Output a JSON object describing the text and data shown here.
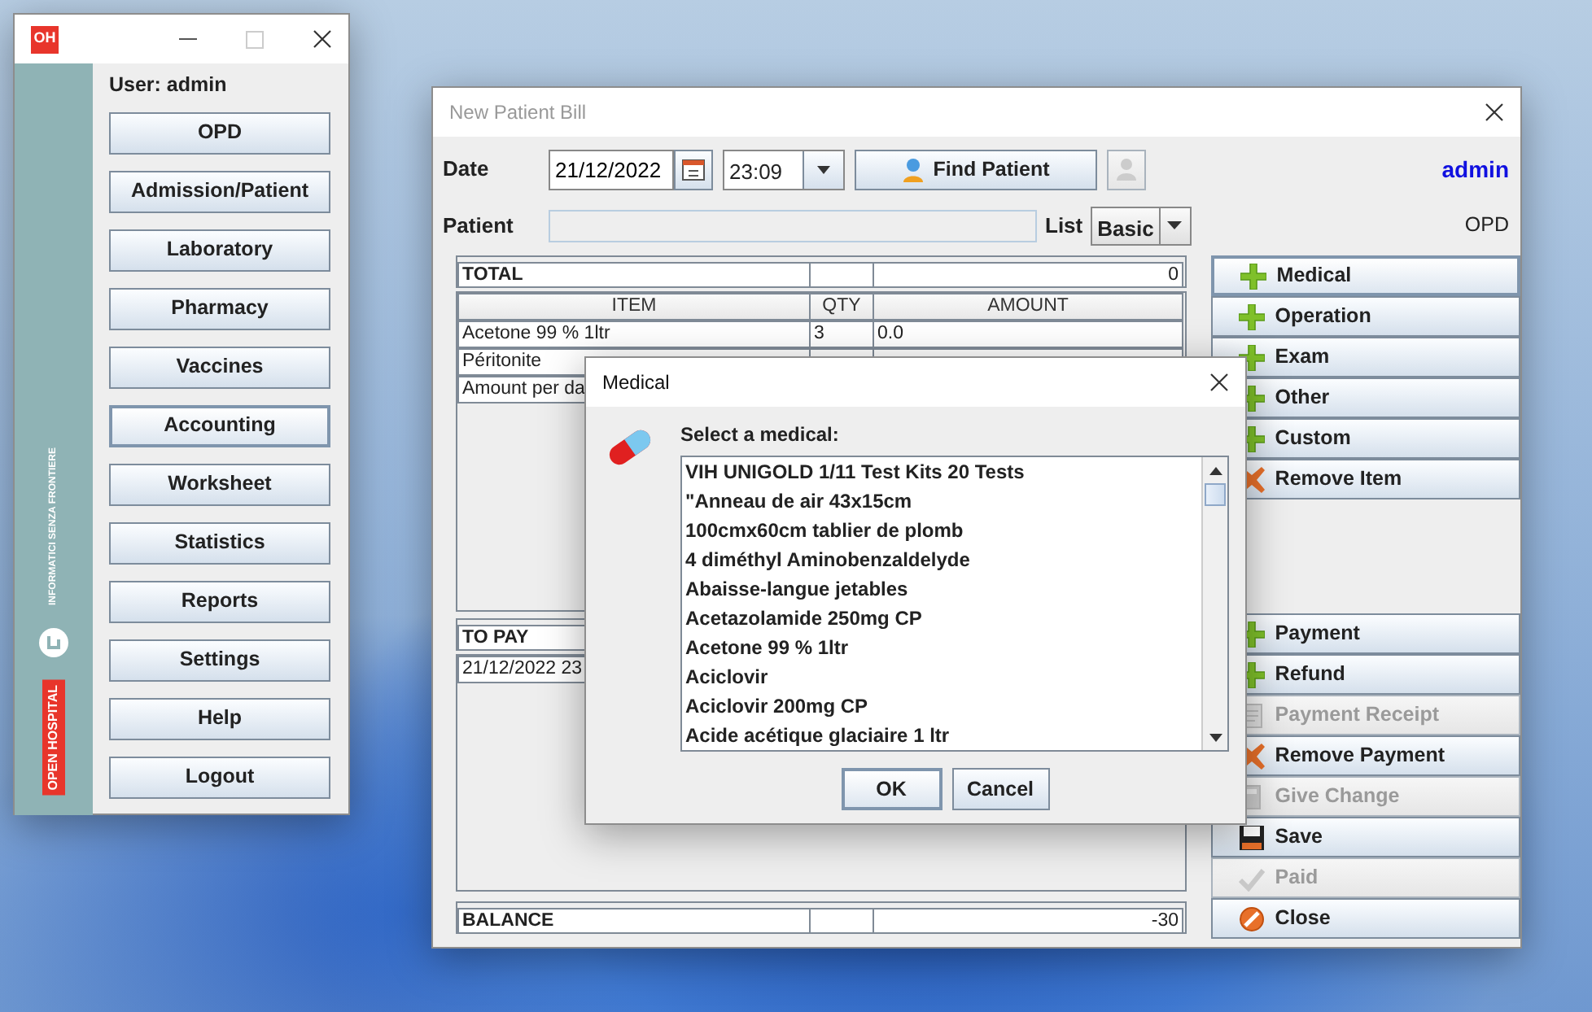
{
  "main_window": {
    "logo_text": "OH",
    "user_label": "User: admin",
    "brand": "OPEN HOSPITAL",
    "partner": "INFORMATICI SENZA FRONTIERE",
    "buttons": [
      {
        "label": "OPD",
        "focused": false
      },
      {
        "label": "Admission/Patient",
        "focused": false
      },
      {
        "label": "Laboratory",
        "focused": false
      },
      {
        "label": "Pharmacy",
        "focused": false
      },
      {
        "label": "Vaccines",
        "focused": false
      },
      {
        "label": "Accounting",
        "focused": true
      },
      {
        "label": "Worksheet",
        "focused": false
      },
      {
        "label": "Statistics",
        "focused": false
      },
      {
        "label": "Reports",
        "focused": false
      },
      {
        "label": "Settings",
        "focused": false
      },
      {
        "label": "Help",
        "focused": false
      },
      {
        "label": "Logout",
        "focused": false
      }
    ]
  },
  "bill_window": {
    "title": "New Patient Bill",
    "date_label": "Date",
    "date": "21/12/2022",
    "time": "23:09",
    "find_patient": {
      "label": "Find Patient"
    },
    "patient_label": "Patient",
    "list_label": "List",
    "list_value": "Basic",
    "user": "admin",
    "ward": "OPD",
    "total": {
      "label": "TOTAL",
      "value": "0"
    },
    "columns": [
      "ITEM",
      "QTY",
      "AMOUNT"
    ],
    "items": [
      {
        "item": "Acetone 99 % 1ltr",
        "qty": "3",
        "amount": "0.0"
      },
      {
        "item": "Péritonite"
      },
      {
        "item": "Amount per da"
      }
    ],
    "to_pay": {
      "label": "TO PAY"
    },
    "payments": [
      {
        "text": "21/12/2022 23"
      }
    ],
    "balance": {
      "label": "BALANCE",
      "value": "-30"
    },
    "item_actions": [
      {
        "label": "Medical",
        "kind": "add",
        "disabled": false,
        "focused": true
      },
      {
        "label": "Operation",
        "kind": "add",
        "disabled": false,
        "focused": false
      },
      {
        "label": "Exam",
        "kind": "add",
        "disabled": false,
        "focused": false
      },
      {
        "label": "Other",
        "kind": "add",
        "disabled": false,
        "focused": false
      },
      {
        "label": "Custom",
        "kind": "add",
        "disabled": false,
        "focused": false
      },
      {
        "label": "Remove Item",
        "kind": "remove",
        "disabled": false,
        "focused": false
      }
    ],
    "payment_actions": [
      {
        "label": "Payment",
        "kind": "add",
        "disabled": false,
        "focused": false
      },
      {
        "label": "Refund",
        "kind": "add",
        "disabled": false,
        "focused": false
      },
      {
        "label": "Payment Receipt",
        "kind": "receipt",
        "disabled": true,
        "focused": false
      },
      {
        "label": "Remove Payment",
        "kind": "remove",
        "disabled": false,
        "focused": false
      },
      {
        "label": "Give Change",
        "kind": "change",
        "disabled": true,
        "focused": false
      },
      {
        "label": "Save",
        "kind": "save",
        "disabled": false,
        "focused": false
      },
      {
        "label": "Paid",
        "kind": "paid",
        "disabled": true,
        "focused": false
      },
      {
        "label": "Close",
        "kind": "close",
        "disabled": false,
        "focused": false
      }
    ]
  },
  "medical_dialog": {
    "title": "Medical",
    "prompt": "Select a medical:",
    "options": [
      "VIH UNIGOLD 1/11 Test Kits 20 Tests",
      "\"Anneau de air 43x15cm",
      "100cmx60cm tablier de plomb",
      "4 diméthyl Aminobenzaldelyde",
      "Abaisse-langue jetables",
      "Acetazolamide 250mg CP",
      "Acetone 99 % 1ltr",
      "Aciclovir",
      "Aciclovir 200mg CP",
      "Acide acétique glaciaire 1 ltr"
    ],
    "buttons": [
      {
        "label": "OK",
        "default": true
      },
      {
        "label": "Cancel",
        "default": false
      }
    ]
  }
}
